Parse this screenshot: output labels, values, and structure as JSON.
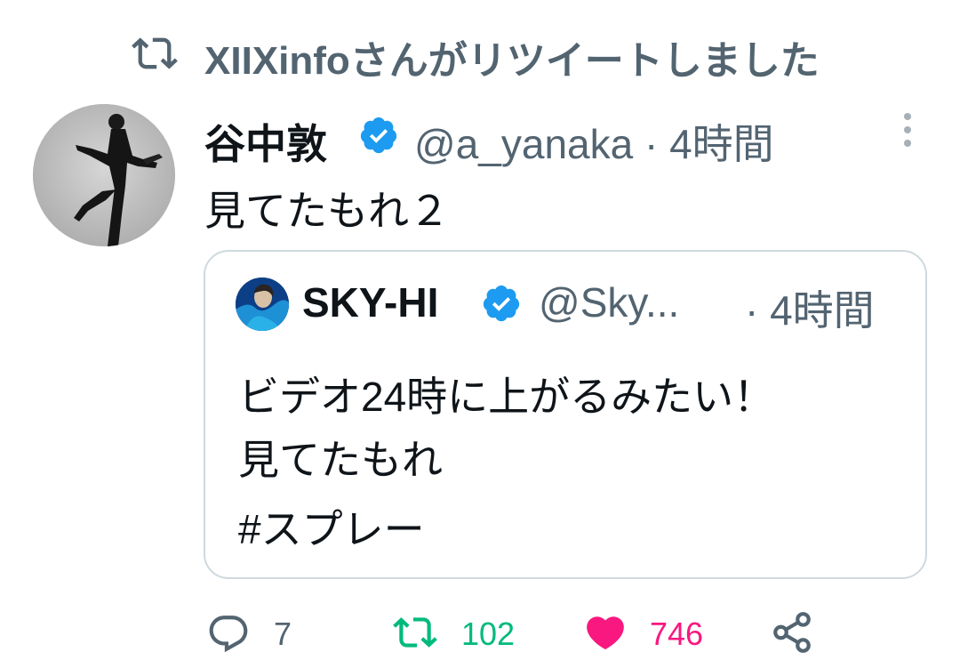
{
  "retweet_header": {
    "text": "XIIXinfoさんがリツイートしました",
    "icon": "retweet-icon"
  },
  "tweet": {
    "author_name": "谷中敦",
    "author_handle": "@a_yanaka · 4時間",
    "verified_icon": "verified-badge-icon",
    "more_icon": "more-vertical-icon",
    "text": "見てたもれ２",
    "quote": {
      "author_name": "SKY-HI",
      "author_handle": "@Sky...",
      "time": "· 4時間",
      "lines": [
        "ビデオ24時に上がるみたい！",
        "見てたもれ",
        "#スプレー"
      ]
    },
    "actions": {
      "reply_count": "7",
      "retweet_count": "102",
      "like_count": "746",
      "reply_icon": "reply-bubble-icon",
      "retweet_icon": "retweet-icon",
      "like_icon": "heart-icon",
      "share_icon": "share-icon"
    }
  },
  "colors": {
    "text_primary": "#0f1419",
    "text_secondary": "#536471",
    "verified": "#1d9bf0",
    "retweet_active": "#00ba7c",
    "like_active": "#f91880",
    "border": "#cfd9de"
  }
}
